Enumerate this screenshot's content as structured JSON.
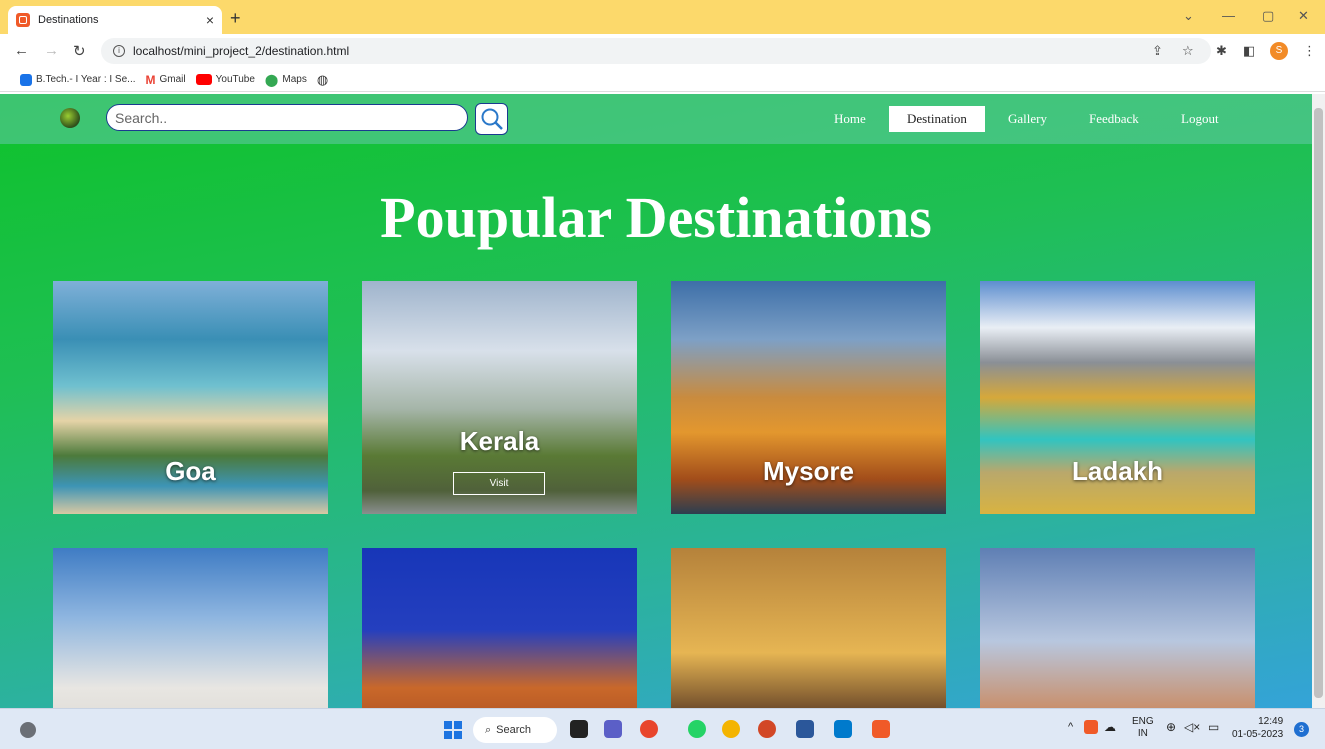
{
  "browser": {
    "tab_title": "Destinations",
    "tab_close": "×",
    "new_tab": "+",
    "url": "localhost/mini_project_2/destination.html",
    "bookmarks": [
      {
        "label": "B.Tech.- I Year : I Se...",
        "color": "#1a73e8"
      },
      {
        "label": "Gmail",
        "color": "#ea4335"
      },
      {
        "label": "YouTube",
        "color": "#ff0000"
      },
      {
        "label": "Maps",
        "color": "#34a853"
      },
      {
        "label": "",
        "color": "#333333"
      }
    ],
    "profile_initial": "S"
  },
  "site": {
    "search_placeholder": "Search..",
    "nav": [
      "Home",
      "Destination",
      "Gallery",
      "Feedback",
      "Logout"
    ],
    "active_nav": "Destination",
    "heading": "Poupular Destinations",
    "visit_label": "Visit",
    "destinations": [
      "Goa",
      "Kerala",
      "Mysore",
      "Ladakh"
    ],
    "colors": {
      "accent_green": "#0ec22a",
      "accent_blue": "#34a3d8"
    }
  },
  "taskbar": {
    "search_label": "Search",
    "lang_top": "ENG",
    "lang_bottom": "IN",
    "time": "12:49",
    "date": "01-05-2023",
    "notification_count": "3"
  }
}
